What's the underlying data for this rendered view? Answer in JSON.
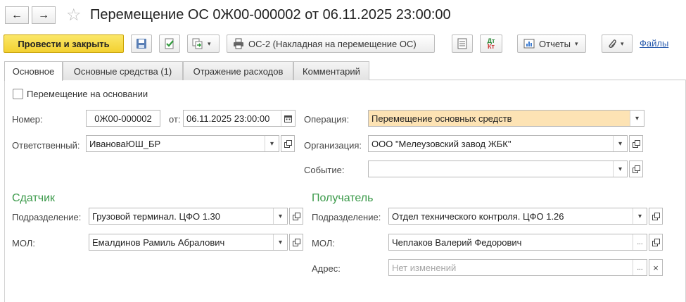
{
  "window": {
    "back_label": "←",
    "forward_label": "→",
    "title": "Перемещение ОС 0Ж00-000002 от 06.11.2025 23:00:00"
  },
  "toolbar": {
    "post_close_label": "Провести и закрыть",
    "print_label": "ОС-2 (Накладная на перемещение ОС)",
    "dtkt_top": "Дт",
    "dtkt_bottom": "Кт",
    "reports_label": "Отчеты",
    "files_label": "Файлы"
  },
  "tabs": [
    {
      "label": "Основное",
      "active": true
    },
    {
      "label": "Основные средства (1)",
      "active": false
    },
    {
      "label": "Отражение расходов",
      "active": false
    },
    {
      "label": "Комментарий",
      "active": false
    }
  ],
  "form": {
    "based_on_label": "Перемещение на основании",
    "number_label": "Номер:",
    "number_value": "0Ж00-000002",
    "date_label": "от:",
    "date_value": "06.11.2025 23:00:00",
    "operation_label": "Операция:",
    "operation_value": "Перемещение основных средств",
    "responsible_label": "Ответственный:",
    "responsible_value": "ИвановаЮШ_БР",
    "organization_label": "Организация:",
    "organization_value": "ООО \"Мелеузовский завод ЖБК\"",
    "event_label": "Событие:",
    "event_value": ""
  },
  "sender": {
    "title": "Сдатчик",
    "department_label": "Подразделение:",
    "department_value": "Грузовой терминал. ЦФО 1.30",
    "mol_label": "МОЛ:",
    "mol_value": "Емалдинов Рамиль Абралович"
  },
  "receiver": {
    "title": "Получатель",
    "department_label": "Подразделение:",
    "department_value": "Отдел технического контроля. ЦФО 1.26",
    "mol_label": "МОЛ:",
    "mol_value": "Чеплаков Валерий Федорович",
    "address_label": "Адрес:",
    "address_placeholder": "Нет изменений"
  },
  "glyphs": {
    "dropdown": "▾",
    "ellipsis": "...",
    "clear": "×",
    "star": "☆"
  },
  "colors": {
    "primary_button": "#f3d131",
    "highlight_field": "#fde3b4",
    "section_title": "#3b9a4a",
    "link": "#2a5cae"
  }
}
